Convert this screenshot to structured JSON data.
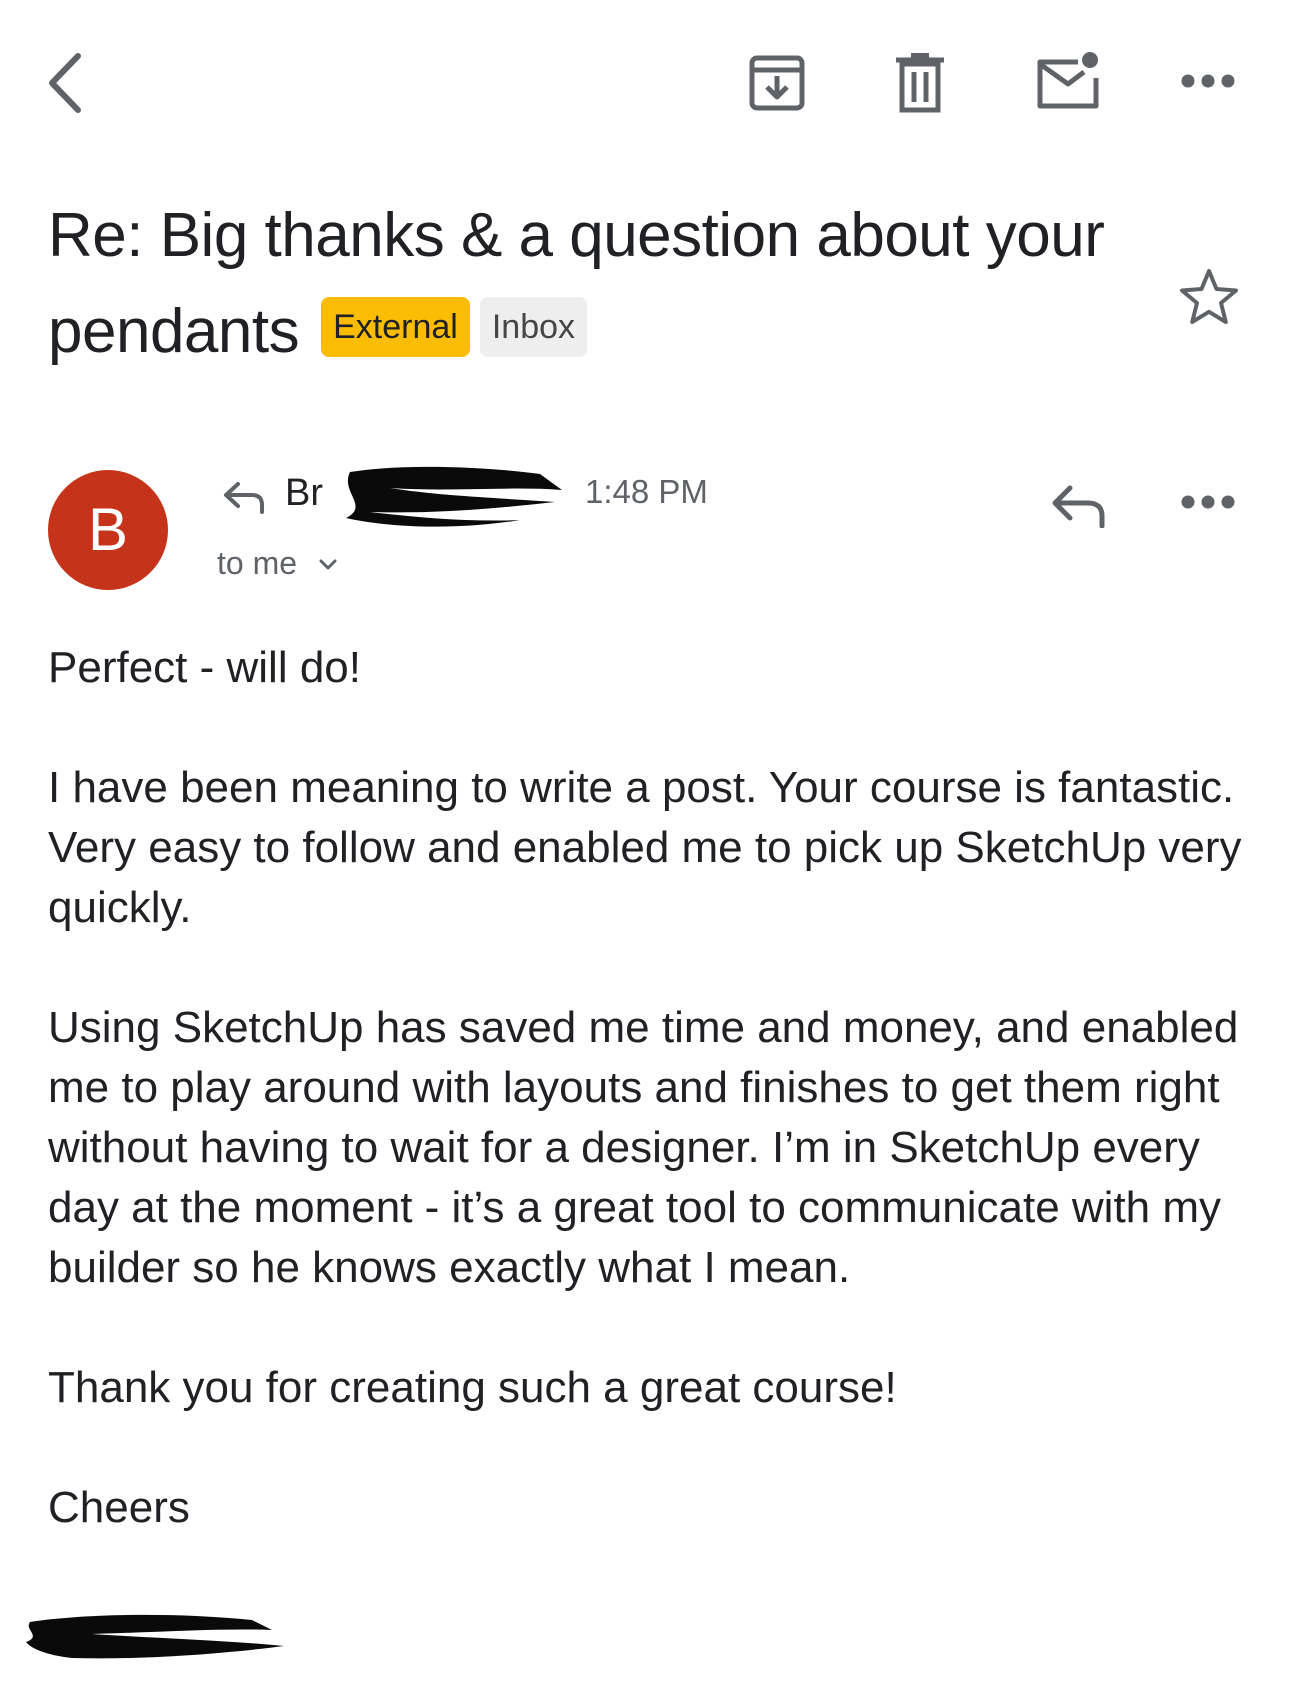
{
  "toolbar": {
    "back": "chevron-left-icon",
    "archive": "archive-icon",
    "delete": "trash-icon",
    "mark_unread": "mark-unread-icon",
    "more": "more-horizontal-icon"
  },
  "email": {
    "subject": "Re: Big thanks & a question about your pendants",
    "labels": [
      "External",
      "Inbox"
    ],
    "starred": false,
    "sender_initial": "B",
    "sender_name_visible": "Br",
    "time": "1:48 PM",
    "recipient": "to me",
    "body": [
      "Perfect - will do!",
      "I have been meaning to write a post. Your course is fantastic. Very easy to follow and enabled me to pick up SketchUp very quickly.",
      "Using SketchUp has saved me time and money, and enabled me to play around with layouts and finishes to get them right without having to wait for a designer. I’m in SketchUp every day at the moment - it’s a great tool to communicate with my builder so he knows exactly what I mean.",
      "Thank you for creating such a great course!",
      "Cheers"
    ]
  },
  "colors": {
    "avatar": "#c5341a",
    "external_label": "#fbbc04",
    "inbox_label": "#eeeeee",
    "icon": "#5f6368"
  }
}
